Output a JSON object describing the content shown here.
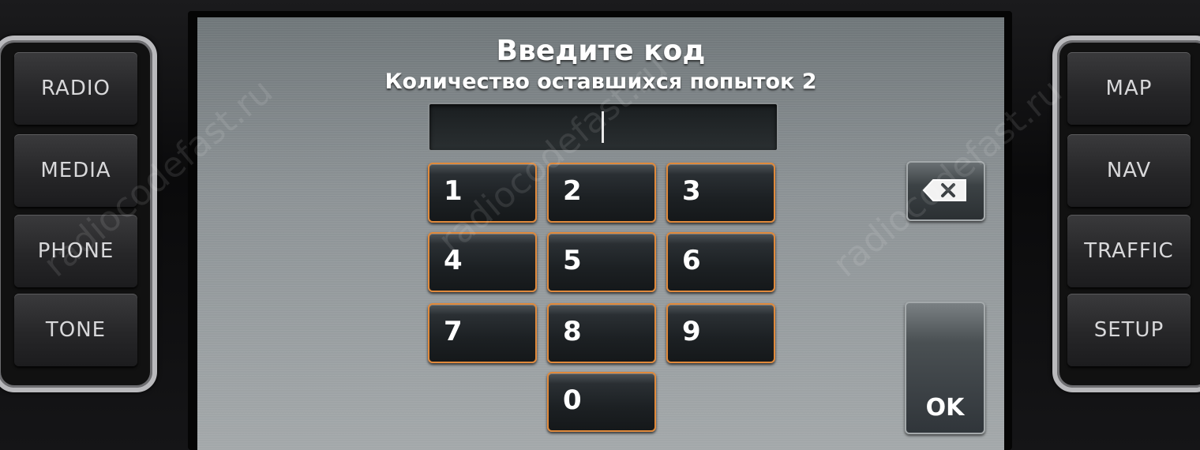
{
  "left_buttons": [
    {
      "label": "RADIO"
    },
    {
      "label": "MEDIA"
    },
    {
      "label": "PHONE"
    },
    {
      "label": "TONE"
    }
  ],
  "right_buttons": [
    {
      "label": "MAP"
    },
    {
      "label": "NAV"
    },
    {
      "label": "TRAFFIC"
    },
    {
      "label": "SETUP"
    }
  ],
  "screen": {
    "title": "Введите код",
    "subtitle": "Количество оставшихся попыток 2",
    "code_value": "",
    "keys": [
      "1",
      "2",
      "3",
      "4",
      "5",
      "6",
      "7",
      "8",
      "9",
      "0"
    ],
    "backspace_icon": "backspace-icon",
    "ok_label": "OK"
  },
  "watermark": "radiocodefast.ru",
  "colors": {
    "key_border": "#e08a3c",
    "screen_bg": "#8c9295"
  }
}
